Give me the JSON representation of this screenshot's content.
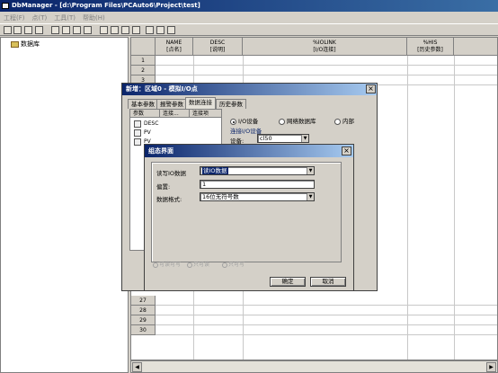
{
  "window": {
    "title": "DbManager - [d:\\Program Files\\PCAuto6\\Project\\test]"
  },
  "menu": [
    "工程(F)",
    "点(T)",
    "工具(T)",
    "帮助(H)"
  ],
  "tree": {
    "root": "数据库"
  },
  "grid": {
    "columns": [
      {
        "en": "NAME",
        "zh": "[点名]"
      },
      {
        "en": "DESC",
        "zh": "[说明]"
      },
      {
        "en": "%IOLINK",
        "zh": "[I/O连接]"
      },
      {
        "en": "%HIS",
        "zh": "[历史参数]"
      }
    ],
    "rows_top": [
      "1",
      "2",
      "3"
    ],
    "rows_bottom": [
      "27",
      "28",
      "29",
      "30"
    ]
  },
  "var_dialog": {
    "title": "新增：区域0 - 模拟I/O点",
    "tabs": [
      "基本参数",
      "报警参数",
      "数据连接",
      "历史参数"
    ],
    "param_headers": [
      "参数",
      "连接...",
      "连接项"
    ],
    "params": [
      "DESC",
      "PV",
      "PV"
    ],
    "radios": [
      "I/O设备",
      "网络数据库",
      "内部"
    ],
    "io_group_label": "连接I/O设备",
    "device_label": "设备:",
    "device_value": "cl50"
  },
  "group_dialog": {
    "title": "组态界面",
    "read_label": "读写IO数据",
    "read_value": "读IO数据",
    "offset_label": "偏置:",
    "offset_value": "1",
    "format_label": "数据格式:",
    "format_value": "16位无符号数",
    "access": [
      "可读可写",
      "只可读",
      "只可写"
    ],
    "ok": "确定",
    "cancel": "取消"
  }
}
